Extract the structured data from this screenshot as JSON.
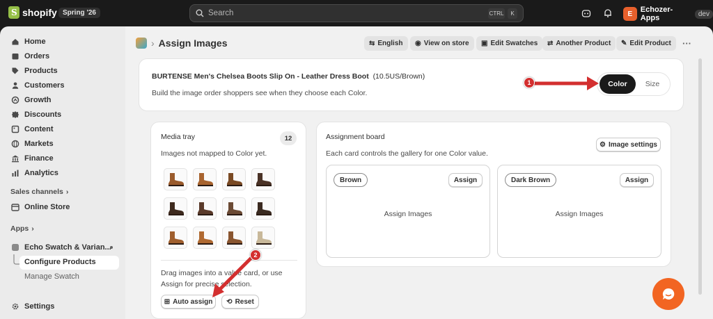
{
  "topbar": {
    "brand": "shopify",
    "edition": "Spring '26",
    "search_placeholder": "Search",
    "kbd1": "CTRL",
    "kbd2": "K",
    "store_name": "Echozer-Apps",
    "store_tag": "dev",
    "store_initial": "E"
  },
  "sidebar": {
    "items": [
      {
        "label": "Home",
        "icon": "home-icon"
      },
      {
        "label": "Orders",
        "icon": "orders-icon"
      },
      {
        "label": "Products",
        "icon": "tag-icon"
      },
      {
        "label": "Customers",
        "icon": "person-icon"
      },
      {
        "label": "Growth",
        "icon": "growth-icon"
      },
      {
        "label": "Discounts",
        "icon": "discount-icon"
      },
      {
        "label": "Content",
        "icon": "content-icon"
      },
      {
        "label": "Markets",
        "icon": "globe-icon"
      },
      {
        "label": "Finance",
        "icon": "bank-icon"
      },
      {
        "label": "Analytics",
        "icon": "chart-icon"
      }
    ],
    "sales_channels": "Sales channels",
    "online_store": "Online Store",
    "apps": "Apps",
    "app_name": "Echo Swatch & Varian...",
    "configure": "Configure Products",
    "manage": "Manage Swatch"
  },
  "header": {
    "title": "Assign Images",
    "buttons": [
      "English",
      "View on store",
      "Edit Swatches",
      "Another Product",
      "Edit Product"
    ],
    "more": "···"
  },
  "product": {
    "name": "BURTENSE Men's Chelsea Boots Slip On - Leather Dress Boot",
    "variant": "(10.5US/Brown)",
    "description": "Build the image order shoppers see when they choose each Color.",
    "toggle": {
      "active": "Color",
      "inactive": "Size"
    }
  },
  "tray": {
    "title": "Media tray",
    "count": "12",
    "subtitle": "Images not mapped to Color yet.",
    "hint": "Drag images into a value card, or use Assign for precise selection.",
    "auto_assign": "Auto assign",
    "reset": "Reset"
  },
  "board": {
    "title": "Assignment board",
    "subtitle": "Each card controls the gallery for one Color value.",
    "settings": "Image settings",
    "cards": [
      {
        "value": "Brown",
        "assign": "Assign",
        "placeholder": "Assign Images"
      },
      {
        "value": "Dark Brown",
        "assign": "Assign",
        "placeholder": "Assign Images"
      }
    ]
  },
  "annotations": {
    "first": "1",
    "second": "2"
  },
  "colors": {
    "accent": "#d32f2f",
    "dark": "#1a1a1a",
    "chat": "#f26522",
    "brown": "#8b5a2b"
  }
}
